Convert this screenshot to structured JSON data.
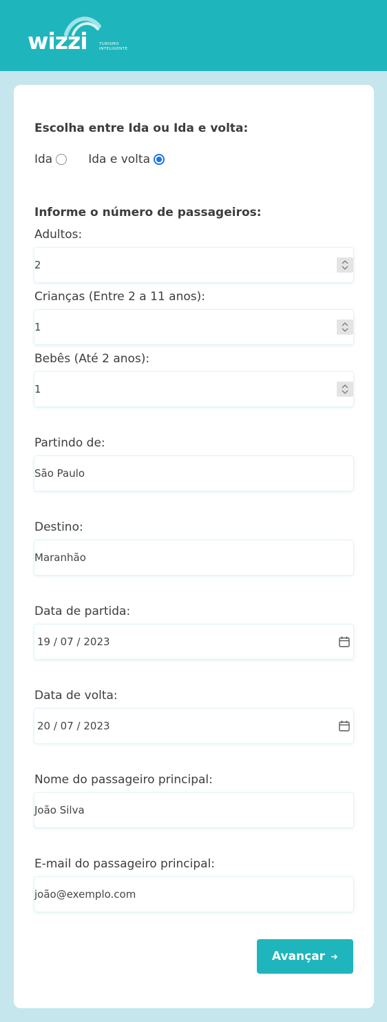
{
  "brand": {
    "name": "wizzi",
    "tagline_line1": "TURISMO",
    "tagline_line2": "INTELIGENTE",
    "header_color": "#1fb5bc"
  },
  "form": {
    "trip_type_title": "Escolha entre Ida ou Ida e volta:",
    "trip_options": [
      {
        "label": "Ida",
        "selected": false
      },
      {
        "label": "Ida e volta",
        "selected": true
      }
    ],
    "passengers_title": "Informe o número de passageiros:",
    "adults": {
      "label": "Adultos:",
      "value": "2"
    },
    "children": {
      "label": "Crianças (Entre 2 a 11 anos):",
      "value": "1"
    },
    "babies": {
      "label": "Bebês (Até 2 anos):",
      "value": "1"
    },
    "origin": {
      "label": "Partindo de:",
      "value": "São Paulo"
    },
    "destination": {
      "label": "Destino:",
      "value": "Maranhão"
    },
    "departure_date": {
      "label": "Data de partida:",
      "value": "19 / 07 / 2023"
    },
    "return_date": {
      "label": "Data de volta:",
      "value": "20 / 07 / 2023"
    },
    "main_passenger_name": {
      "label": "Nome do passageiro principal:",
      "value": "João Silva"
    },
    "main_passenger_email": {
      "label": "E-mail do passageiro principal:",
      "value": "joão@exemplo.com"
    },
    "submit_label": "Avançar",
    "accent_color": "#1fb5bc",
    "radio_color": "#1a73e8"
  },
  "icons": {
    "spinner": "up-down-chevron-icon",
    "calendar": "calendar-icon",
    "submit_arrow": "arrow-right-icon"
  }
}
